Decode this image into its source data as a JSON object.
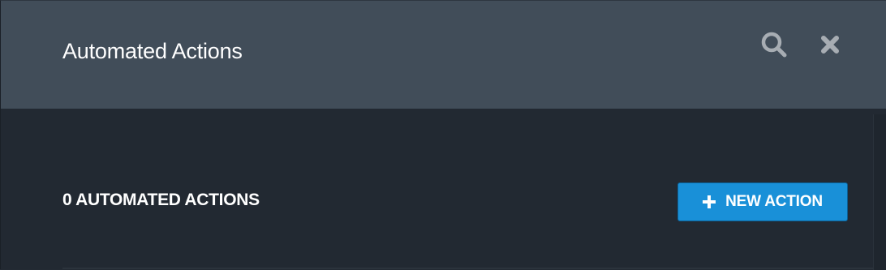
{
  "header": {
    "title": "Automated Actions",
    "icons": {
      "search": "search-icon",
      "close": "close-icon"
    }
  },
  "main": {
    "count_label": "0 AUTOMATED ACTIONS",
    "new_action_button": {
      "icon": "plus-icon",
      "label": "NEW ACTION"
    }
  },
  "colors": {
    "header_bg": "#414d59",
    "body_bg": "#222932",
    "icon_gray": "#a7adb3",
    "accent": "#1990d8"
  }
}
